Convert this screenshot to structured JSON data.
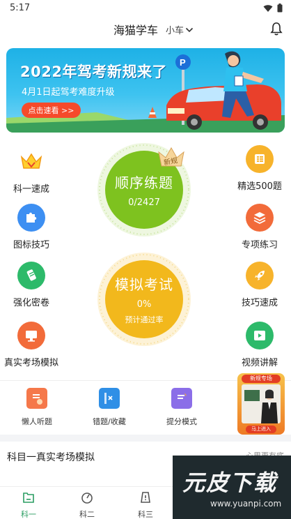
{
  "status_bar": {
    "time": "5:17"
  },
  "header": {
    "title": "海猫学车",
    "vehicle": "小车"
  },
  "banner": {
    "title": "2022年驾考新规来了",
    "subtitle": "4月1日起驾考难度升级",
    "button": "点击速看 >>"
  },
  "left_items": [
    {
      "label": "科一速成",
      "icon": "crown-icon",
      "color": "#ffd34d"
    },
    {
      "label": "图标技巧",
      "icon": "puzzle-icon",
      "color": "#3d8ff2"
    },
    {
      "label": "强化密卷",
      "icon": "scroll-icon",
      "color": "#2dba6a"
    },
    {
      "label": "真实考场模拟",
      "icon": "monitor-icon",
      "color": "#f26b3a"
    }
  ],
  "right_items": [
    {
      "label": "精选500题",
      "icon": "list-icon",
      "color": "#f7b32b"
    },
    {
      "label": "专项练习",
      "icon": "layers-icon",
      "color": "#f26b3a"
    },
    {
      "label": "技巧速成",
      "icon": "rocket-icon",
      "color": "#f7b32b"
    },
    {
      "label": "视频讲解",
      "icon": "video-icon",
      "color": "#2dba6a"
    }
  ],
  "practice": {
    "title": "顺序练题",
    "value": "0/2427",
    "badge": "新规",
    "color": "#7ec21f"
  },
  "exam": {
    "title": "模拟考试",
    "value": "0%",
    "subtitle": "预计通过率",
    "color": "#f2b81c"
  },
  "tools": [
    {
      "label": "懒人听题",
      "icon": "listen-icon"
    },
    {
      "label": "错题/收藏",
      "icon": "mistakes-icon"
    },
    {
      "label": "提分模式",
      "icon": "boost-icon"
    }
  ],
  "promo": {
    "tag": "新规专场",
    "button": "马上进入"
  },
  "section": {
    "title": "科目一真实考场模拟",
    "more": "心里更有底"
  },
  "bottom_nav": [
    {
      "label": "科一",
      "icon": "subject1-icon"
    },
    {
      "label": "科二",
      "icon": "subject2-icon"
    },
    {
      "label": "科三",
      "icon": "subject3-icon"
    }
  ],
  "watermark": {
    "text": "元皮下载",
    "url": "www.yuanpi.com"
  }
}
